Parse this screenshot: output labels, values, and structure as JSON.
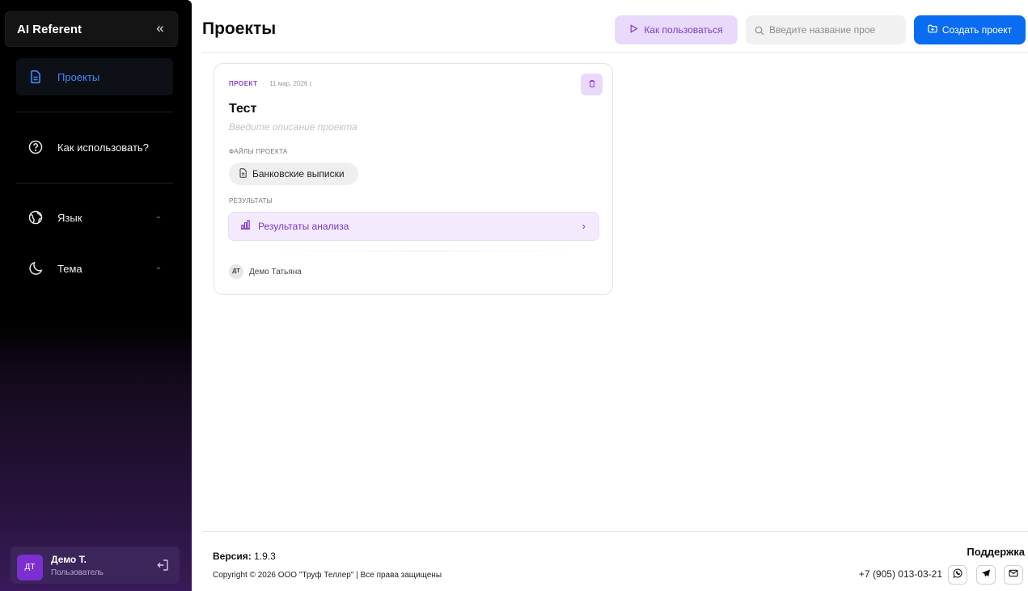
{
  "app": {
    "brand": "AI Referent",
    "collapse_glyph": "«"
  },
  "sidebar": {
    "items": [
      {
        "label": "Проекты",
        "icon": "document-icon"
      },
      {
        "label": "Как использовать?",
        "icon": "help-circle-icon"
      },
      {
        "label": "Язык",
        "icon": "globe-icon"
      },
      {
        "label": "Тема",
        "icon": "moon-icon"
      }
    ],
    "user": {
      "initials": "ДТ",
      "name": "Демо Т.",
      "role": "Пользователь"
    }
  },
  "header": {
    "title": "Проекты",
    "help_label": "Как пользоваться",
    "search_placeholder": "Введите название прое",
    "create_label": "Создать проект"
  },
  "project": {
    "type": "ПРОЕКТ",
    "date": "11 мар. 2026 г.",
    "title": "Тест",
    "description_placeholder": "Введите описание проекта",
    "files_label": "ФАЙЛЫ ПРОЕКТА",
    "file_name": "Банковские выписки",
    "results_label": "РЕЗУЛЬТАТЫ",
    "result_name": "Результаты анализа",
    "owner_initials": "ДТ",
    "owner_name": "Демо Татьяна"
  },
  "footer": {
    "version_label": "Версия:",
    "version": "1.9.3",
    "copyright": "Copyright © 2026 ООО \"Труф Теллер\" | Все права защищены",
    "support_title": "Поддержка",
    "phone": "+7 (905) 013-03-21"
  },
  "colors": {
    "accent": "#0a6cf0",
    "purple": "#7a34c8",
    "purple_light": "#e9d9fb"
  }
}
